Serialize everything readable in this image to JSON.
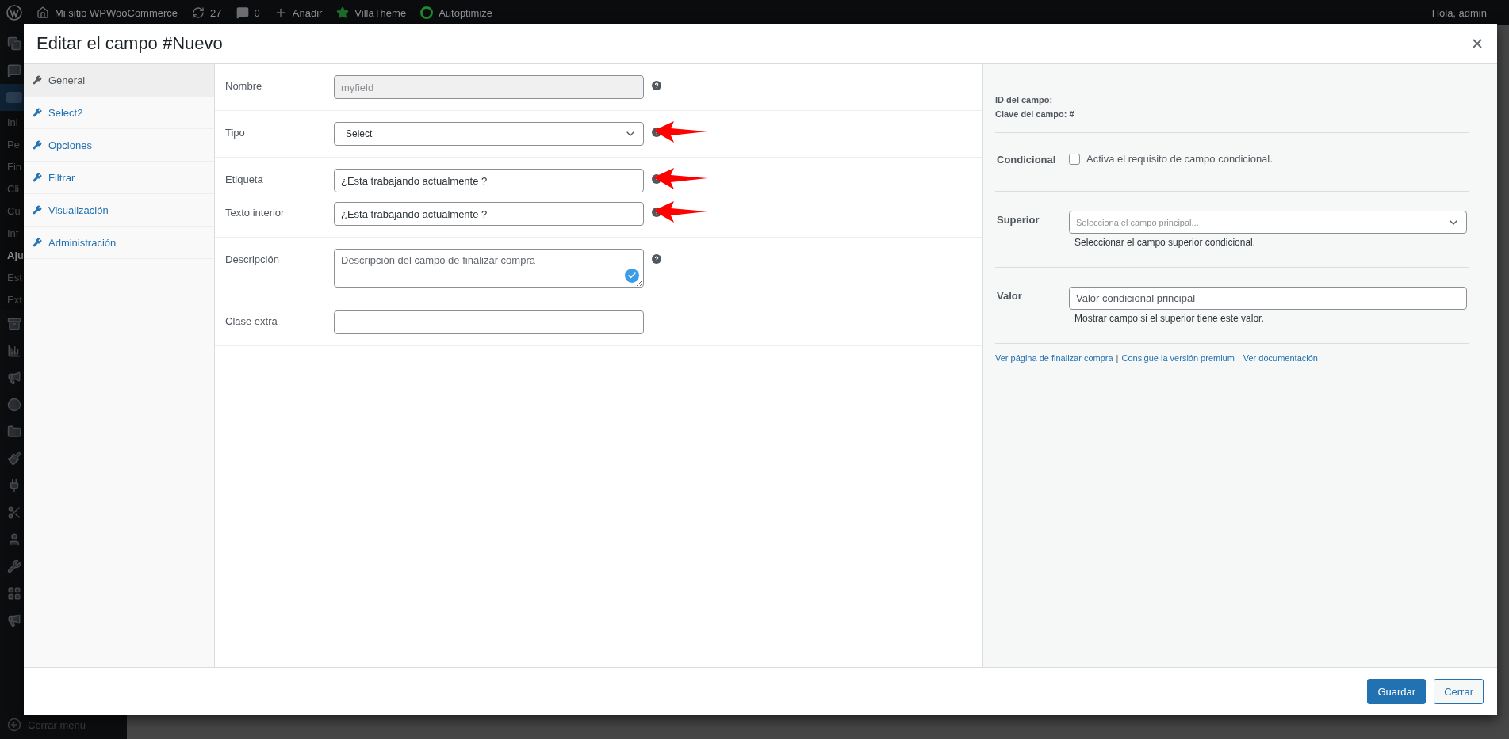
{
  "admin_bar": {
    "items": [
      {
        "kind": "logo"
      },
      {
        "kind": "home",
        "label": "Mi sitio WPWooCommerce"
      },
      {
        "kind": "updates",
        "label": "27"
      },
      {
        "kind": "comments",
        "label": "0"
      },
      {
        "kind": "add",
        "label": "Añadir"
      },
      {
        "kind": "star",
        "label": "VillaTheme"
      },
      {
        "kind": "ring",
        "label": "Autoptimize"
      }
    ],
    "greeting": "Hola, admin"
  },
  "admin_menu": {
    "items": [
      {
        "kind": "icon"
      },
      {
        "kind": "icon"
      },
      {
        "kind": "woo",
        "selected": true
      },
      {
        "kind": "sub",
        "label": "Ini",
        "current": false
      },
      {
        "kind": "sub",
        "label": "Pe",
        "current": false
      },
      {
        "kind": "sub",
        "label": "Fin",
        "current": false
      },
      {
        "kind": "sub",
        "label": "Cli",
        "current": false
      },
      {
        "kind": "sub",
        "label": "Cu",
        "current": false
      },
      {
        "kind": "sub",
        "label": "Inf",
        "current": false
      },
      {
        "kind": "sub",
        "label": "Aju",
        "current": true
      },
      {
        "kind": "sub",
        "label": "Est",
        "current": false
      },
      {
        "kind": "sub",
        "label": "Ext",
        "current": false
      },
      {
        "kind": "icon"
      },
      {
        "kind": "icon"
      },
      {
        "kind": "icon"
      },
      {
        "kind": "icon"
      },
      {
        "kind": "icon"
      },
      {
        "kind": "icon"
      },
      {
        "kind": "icon"
      },
      {
        "kind": "icon"
      },
      {
        "kind": "icon"
      },
      {
        "kind": "icon"
      },
      {
        "kind": "icon"
      },
      {
        "kind": "icon"
      }
    ],
    "collapse": "Cerrar menú"
  },
  "modal": {
    "title": "Editar el campo #Nuevo",
    "nav": [
      {
        "label": "General",
        "selected": true
      },
      {
        "label": "Select2",
        "selected": false
      },
      {
        "label": "Opciones",
        "selected": false
      },
      {
        "label": "Filtrar",
        "selected": false
      },
      {
        "label": "Visualización",
        "selected": false
      },
      {
        "label": "Administración",
        "selected": false
      }
    ],
    "sections": [
      {
        "fields": [
          {
            "label": "Nombre",
            "kind": "text",
            "value": "myfield",
            "disabled": true,
            "help": true,
            "arrow": false
          }
        ]
      },
      {
        "fields": [
          {
            "label": "Tipo",
            "kind": "select",
            "value": "Select",
            "disabled": false,
            "help": true,
            "arrow": true
          }
        ]
      },
      {
        "fields": [
          {
            "label": "Etiqueta",
            "kind": "text",
            "value": "¿Esta trabajando actualmente ?",
            "disabled": false,
            "help": true,
            "arrow": true
          },
          {
            "label": "Texto interior",
            "kind": "text",
            "value": "¿Esta trabajando actualmente ?",
            "disabled": false,
            "help": true,
            "arrow": true
          }
        ]
      },
      {
        "fields": [
          {
            "label": "Descripción",
            "kind": "textarea",
            "placeholder": "Descripción del campo de finalizar compra",
            "disabled": false,
            "help": true,
            "arrow": false
          }
        ]
      },
      {
        "fields": [
          {
            "label": "Clase extra",
            "kind": "text",
            "disabled": false,
            "help": false,
            "arrow": false
          }
        ]
      }
    ],
    "side": {
      "id_label": "ID del campo:",
      "key_label": "Clave del campo: #",
      "conditional": {
        "label": "Condicional",
        "text": "Activa el requisito de campo condicional.",
        "checked": false
      },
      "superior": {
        "label": "Superior",
        "placeholder": "Selecciona el campo principal...",
        "hint": "Seleccionar el campo superior condicional."
      },
      "valor": {
        "label": "Valor",
        "placeholder": "Valor condicional principal",
        "hint": "Mostrar campo si el superior tiene este valor."
      },
      "links": [
        "Ver página de finalizar compra",
        "Consigue la versión premium",
        "Ver documentación"
      ],
      "separator": "|"
    },
    "buttons": [
      {
        "label": "Guardar",
        "kind": "primary"
      },
      {
        "label": "Cerrar",
        "kind": "secondary"
      }
    ]
  }
}
